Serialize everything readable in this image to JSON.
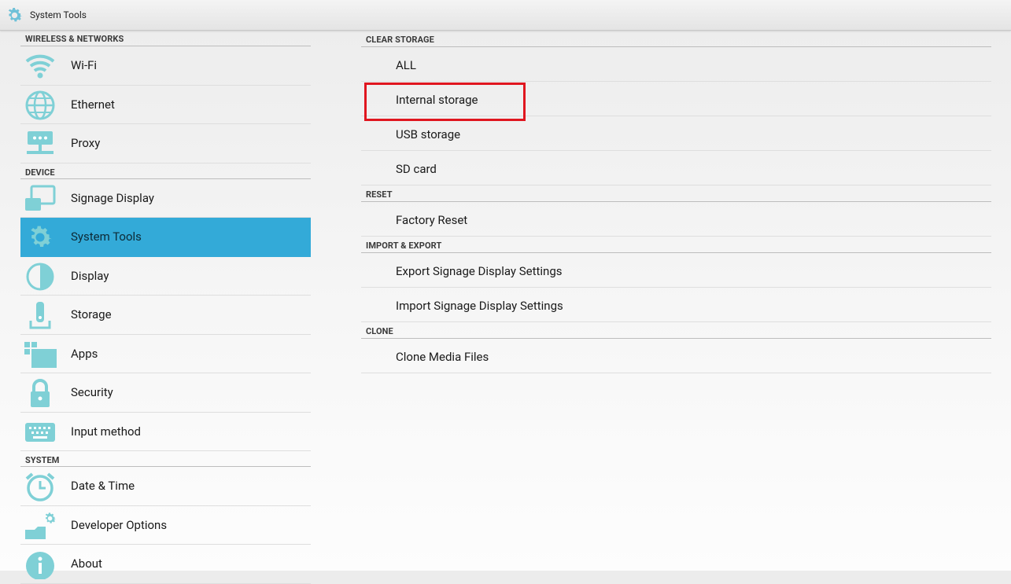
{
  "window": {
    "title": "System Tools",
    "icon": "gear-icon"
  },
  "left_panel": {
    "sections": [
      {
        "header": "WIRELESS & NETWORKS",
        "items": [
          {
            "label": "Wi-Fi",
            "icon": "wifi-icon"
          },
          {
            "label": "Ethernet",
            "icon": "globe-icon"
          },
          {
            "label": "Proxy",
            "icon": "proxy-icon"
          }
        ]
      },
      {
        "header": "DEVICE",
        "items": [
          {
            "label": "Signage Display",
            "icon": "display-screens-icon"
          },
          {
            "label": "System Tools",
            "icon": "gear-icon",
            "selected": true
          },
          {
            "label": "Display",
            "icon": "brightness-icon"
          },
          {
            "label": "Storage",
            "icon": "storage-icon"
          },
          {
            "label": "Apps",
            "icon": "apps-icon"
          },
          {
            "label": "Security",
            "icon": "lock-icon"
          },
          {
            "label": "Input method",
            "icon": "keyboard-icon"
          }
        ]
      },
      {
        "header": "SYSTEM",
        "items": [
          {
            "label": "Date & Time",
            "icon": "clock-icon"
          },
          {
            "label": "Developer Options",
            "icon": "developer-gear-icon"
          },
          {
            "label": "About",
            "icon": "info-icon"
          }
        ]
      }
    ]
  },
  "right_panel": {
    "sections": [
      {
        "header": "CLEAR STORAGE",
        "items": [
          "ALL",
          "Internal storage",
          "USB storage",
          "SD card"
        ]
      },
      {
        "header": "RESET",
        "items": [
          "Factory Reset"
        ]
      },
      {
        "header": "IMPORT & EXPORT",
        "items": [
          "Export Signage Display Settings",
          "Import Signage Display Settings"
        ]
      },
      {
        "header": "CLONE",
        "items": [
          "Clone Media Files"
        ]
      }
    ],
    "highlighted_item": "Internal storage"
  },
  "colors": {
    "accent": "#33aad8",
    "icon": "#7fd0d6",
    "highlight_box": "#e0161f"
  }
}
